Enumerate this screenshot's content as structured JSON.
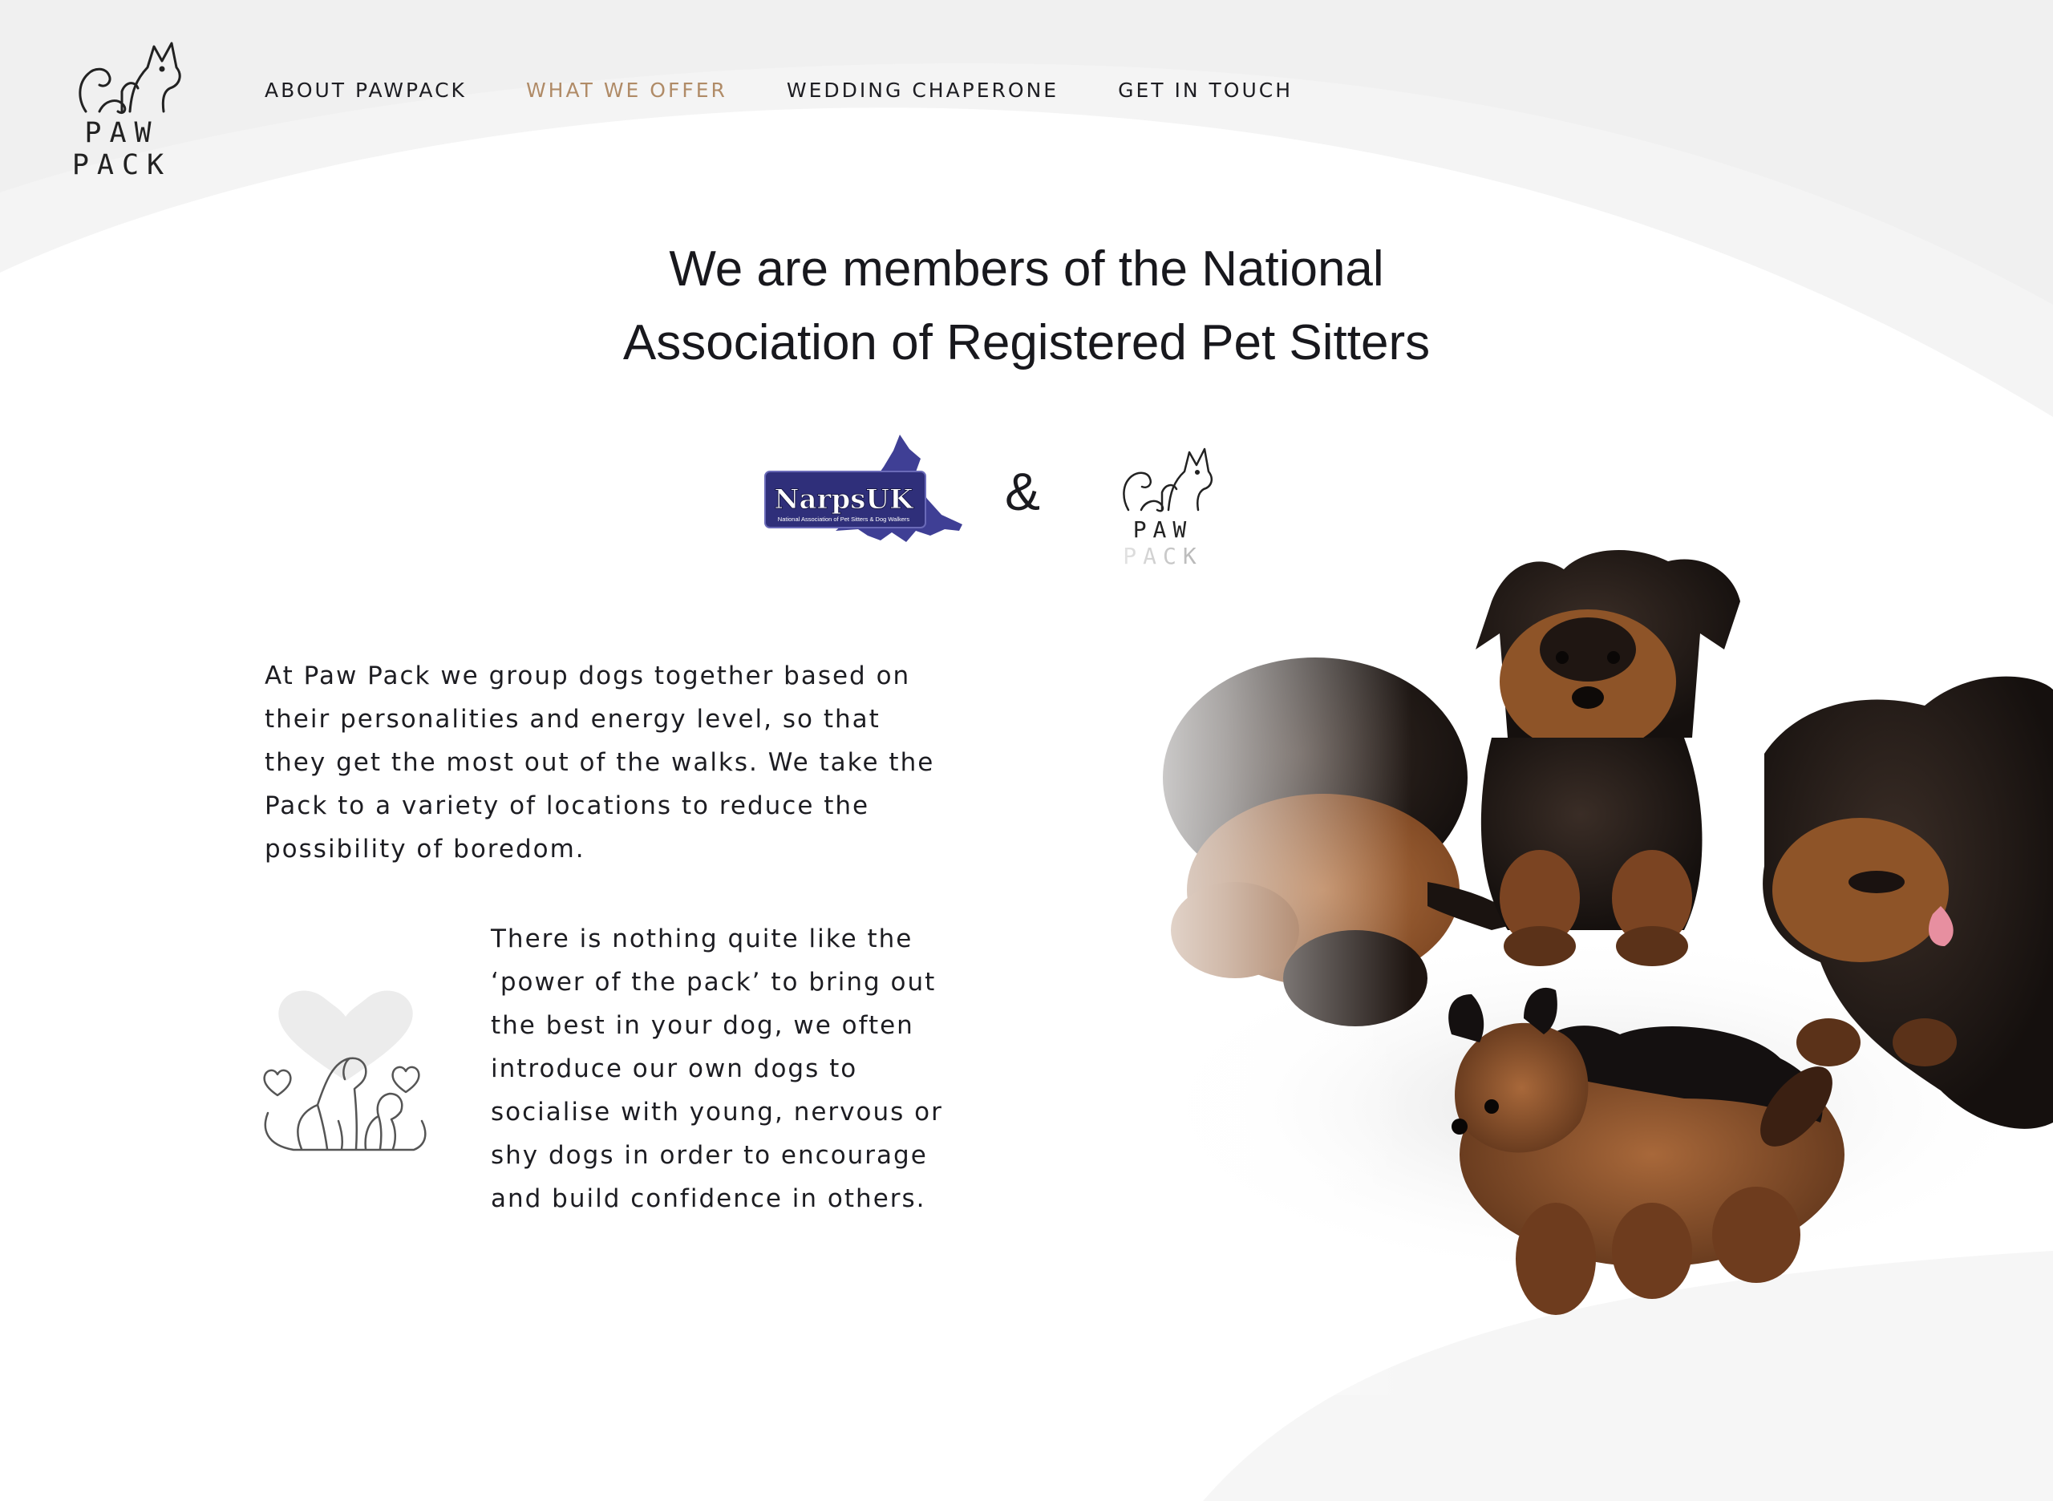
{
  "brand": {
    "logo_text": "PAW PACK"
  },
  "nav": {
    "items": [
      {
        "label": "ABOUT PAWPACK"
      },
      {
        "label": "WHAT WE OFFER",
        "active": true
      },
      {
        "label": "WEDDING CHAPERONE"
      },
      {
        "label": "GET IN TOUCH"
      }
    ]
  },
  "hero": {
    "heading_line1": "We are members of the National",
    "heading_line2": "Association of Registered Pet Sitters"
  },
  "partners": {
    "narps_name": "NarpsUK",
    "narps_subtitle": "National Association of Pet Sitters & Dog Walkers",
    "ampersand": "&",
    "pawpack_logo_text": "PAW PACK"
  },
  "content": {
    "paragraph_1": "At Paw Pack we group dogs together based on their personalities and energy level, so that they get the most out of the walks. We take the Pack to a variety of locations to reduce the possibility of boredom.",
    "paragraph_2": "There is nothing quite like the ‘power of the pack’ to bring out the best in your dog, we often introduce our own dogs to socialise with young, nervous or shy dogs in order to encourage and build confidence in others."
  },
  "colors": {
    "accent": "#b08b67",
    "text": "#1d1d22",
    "narps_blue": "#3a3a8c"
  }
}
